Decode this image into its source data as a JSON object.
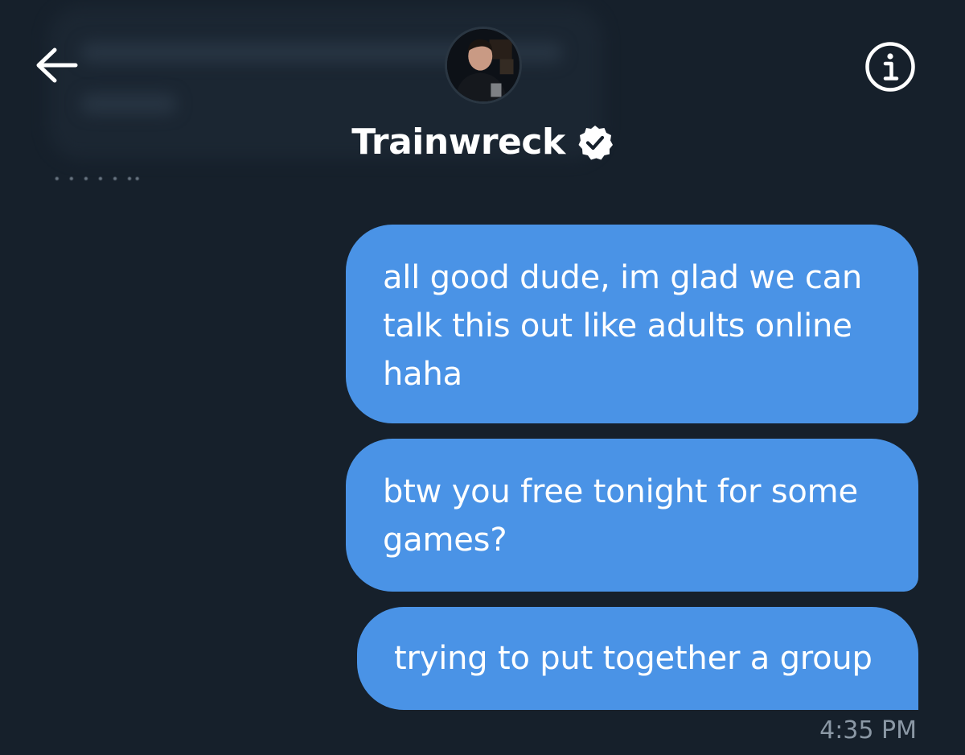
{
  "header": {
    "name": "Trainwreck"
  },
  "messages": [
    {
      "text": "all good dude, im glad we can\ntalk this out like adults online\nhaha"
    },
    {
      "text": "btw you free tonight for some\ngames?"
    },
    {
      "text": "trying to put together a group"
    }
  ],
  "timestamp": "4:35 PM",
  "icons": {
    "back": "arrow-left-icon",
    "verified": "verified-badge-icon",
    "info": "info-icon"
  },
  "colors": {
    "background": "#16202b",
    "bubble": "#4a93e6",
    "timestamp": "#8b98a5"
  }
}
